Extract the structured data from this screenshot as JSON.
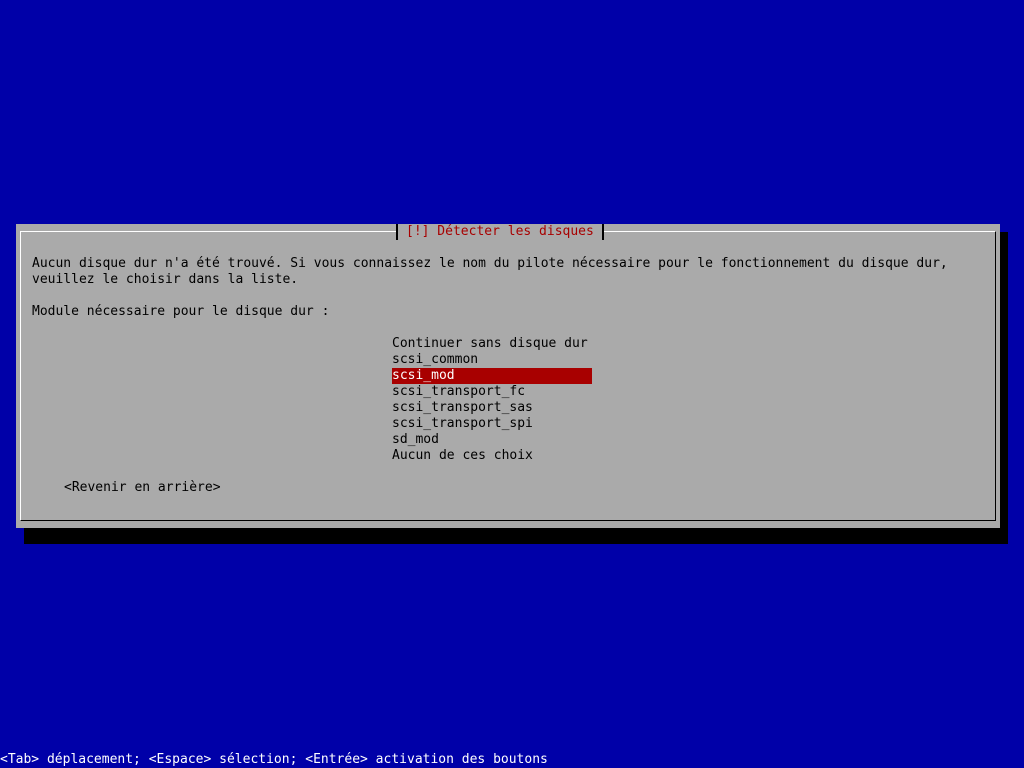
{
  "dialog": {
    "title": "[!] Détecter les disques",
    "message_line1": "Aucun disque dur n'a été trouvé. Si vous connaissez le nom du pilote nécessaire pour le fonctionnement du disque dur,",
    "message_line2": "veuillez le choisir dans la liste.",
    "prompt": "Module nécessaire pour le disque dur :",
    "options": [
      {
        "label": "Continuer sans disque dur"
      },
      {
        "label": "scsi_common"
      },
      {
        "label": "scsi_mod",
        "selected": true
      },
      {
        "label": "scsi_transport_fc"
      },
      {
        "label": "scsi_transport_sas"
      },
      {
        "label": "scsi_transport_spi"
      },
      {
        "label": "sd_mod"
      },
      {
        "label": "Aucun de ces choix"
      }
    ],
    "back_button": "<Revenir en arrière>"
  },
  "status_bar": {
    "help_text": "<Tab> déplacement; <Espace> sélection; <Entrée> activation des boutons"
  },
  "colors": {
    "background": "#0000a8",
    "dialog": "#aaaaaa",
    "title": "#a80000",
    "selection": "#a80000"
  }
}
